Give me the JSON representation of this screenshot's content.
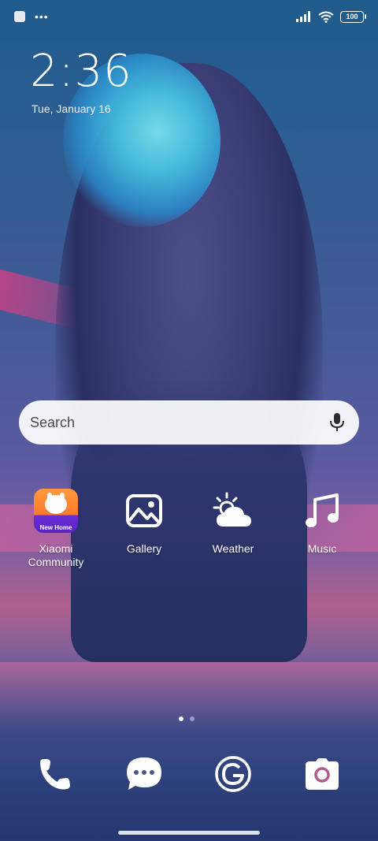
{
  "status_bar": {
    "overflow": "•••",
    "battery": "100"
  },
  "clock": {
    "time": "2:36",
    "date": "Tue, January 16"
  },
  "search": {
    "placeholder": "Search"
  },
  "apps": [
    {
      "label": "Xiaomi Community",
      "badge": "New Home",
      "icon": "xiaomi-community-icon"
    },
    {
      "label": "Gallery",
      "icon": "gallery-icon"
    },
    {
      "label": "Weather",
      "icon": "weather-icon"
    },
    {
      "label": "Music",
      "icon": "music-icon"
    }
  ],
  "dock": [
    {
      "name": "Phone",
      "icon": "phone-icon"
    },
    {
      "name": "Messages",
      "icon": "message-icon"
    },
    {
      "name": "Google",
      "icon": "google-icon"
    },
    {
      "name": "Camera",
      "icon": "camera-icon"
    }
  ],
  "pages": {
    "total": 2,
    "current": 1
  }
}
